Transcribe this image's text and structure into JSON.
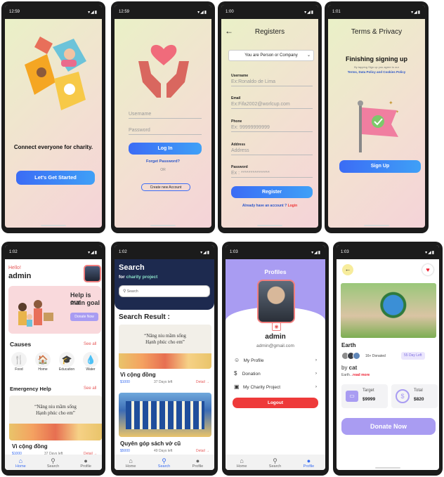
{
  "s1": {
    "time": "12:59",
    "status": "▾◢▮",
    "tagline": "Connect everyone for charity.",
    "cta": "Let's Get Started"
  },
  "s2": {
    "time": "12:59",
    "username": "Username",
    "password": "Password",
    "login": "Log In",
    "forgot": "Forget Password?",
    "or": "OR",
    "create": "Create new Account"
  },
  "s3": {
    "time": "1:00",
    "title": "Registers",
    "select": "You are Person or Company",
    "fields": [
      {
        "label": "Username",
        "ph": "Ex:Ronaldo de Lima"
      },
      {
        "label": "Email",
        "ph": "Ex:Fifa2002@worlcup.com"
      },
      {
        "label": "Phone",
        "ph": "Ex: 99999999999"
      },
      {
        "label": "Address",
        "ph": "Address"
      },
      {
        "label": "Password",
        "ph": "Ex : ***************"
      }
    ],
    "register": "Register",
    "have": "Already have an account ? ",
    "login": "Login"
  },
  "s4": {
    "time": "1:01",
    "title": "Terms & Privacy",
    "heading": "Finishing signing up",
    "sub": "By tapping Sign up you agree to our",
    "policy": "Terms, Data Policy and Cookies Policy",
    "signup": "Sign Up"
  },
  "s5": {
    "time": "1:02",
    "hello": "Hello!",
    "name": "admin",
    "banner1": "Help is our",
    "banner2": "main goal",
    "donate": "Donate Now",
    "causes": "Causes",
    "seeall": "See all",
    "cats": [
      "Food",
      "Home",
      "Education",
      "Water"
    ],
    "emergency": "Emergency Help",
    "seeall2": "See all",
    "poster1": "“Nâng niu mầm sống",
    "poster2": "Hạnh phúc cho em”",
    "card_title": "Vì cộng đồng",
    "amount": "$1000",
    "days": "37 Days left",
    "detail": "Detail →"
  },
  "s6": {
    "time": "1:02",
    "title": "Search",
    "sub1": "for ",
    "sub2": "charity project",
    "search_ph": "Search",
    "result": "Search Result :",
    "c1_title": "Vì cộng đồng",
    "c1_amount": "$1000",
    "c1_days": "37 Days left",
    "c1_detail": "Detail →",
    "c2_title": "Quyên góp sách vở cũ",
    "c2_amount": "$5000",
    "c2_days": "49 Days left",
    "c2_detail": "Detail →",
    "poster1": "“Nâng niu mầm sống",
    "poster2": "Hạnh phúc cho em”"
  },
  "s7": {
    "time": "1:03",
    "title": "Profiles",
    "name": "admin",
    "email": "admin@gmail.com",
    "items": [
      "My Profile",
      "Donation",
      "My Charity Project"
    ],
    "logout": "Logout"
  },
  "s8": {
    "time": "1:03",
    "name": "Earth",
    "donated": "16+ Donated",
    "days": "55 Day Left",
    "by": "by ",
    "owner": "cat",
    "desc": "Earth...",
    "more": "read more",
    "target_label": "Target",
    "target": "$9999",
    "total_label": "Total",
    "total": "$820",
    "donate": "Donate Now"
  },
  "tabs": [
    "Home",
    "Search",
    "Profile"
  ],
  "colors": {
    "blue": "#3b6cf5",
    "purple": "#a99cf2",
    "navy": "#1d2a4f",
    "red": "#ee3a3a"
  }
}
